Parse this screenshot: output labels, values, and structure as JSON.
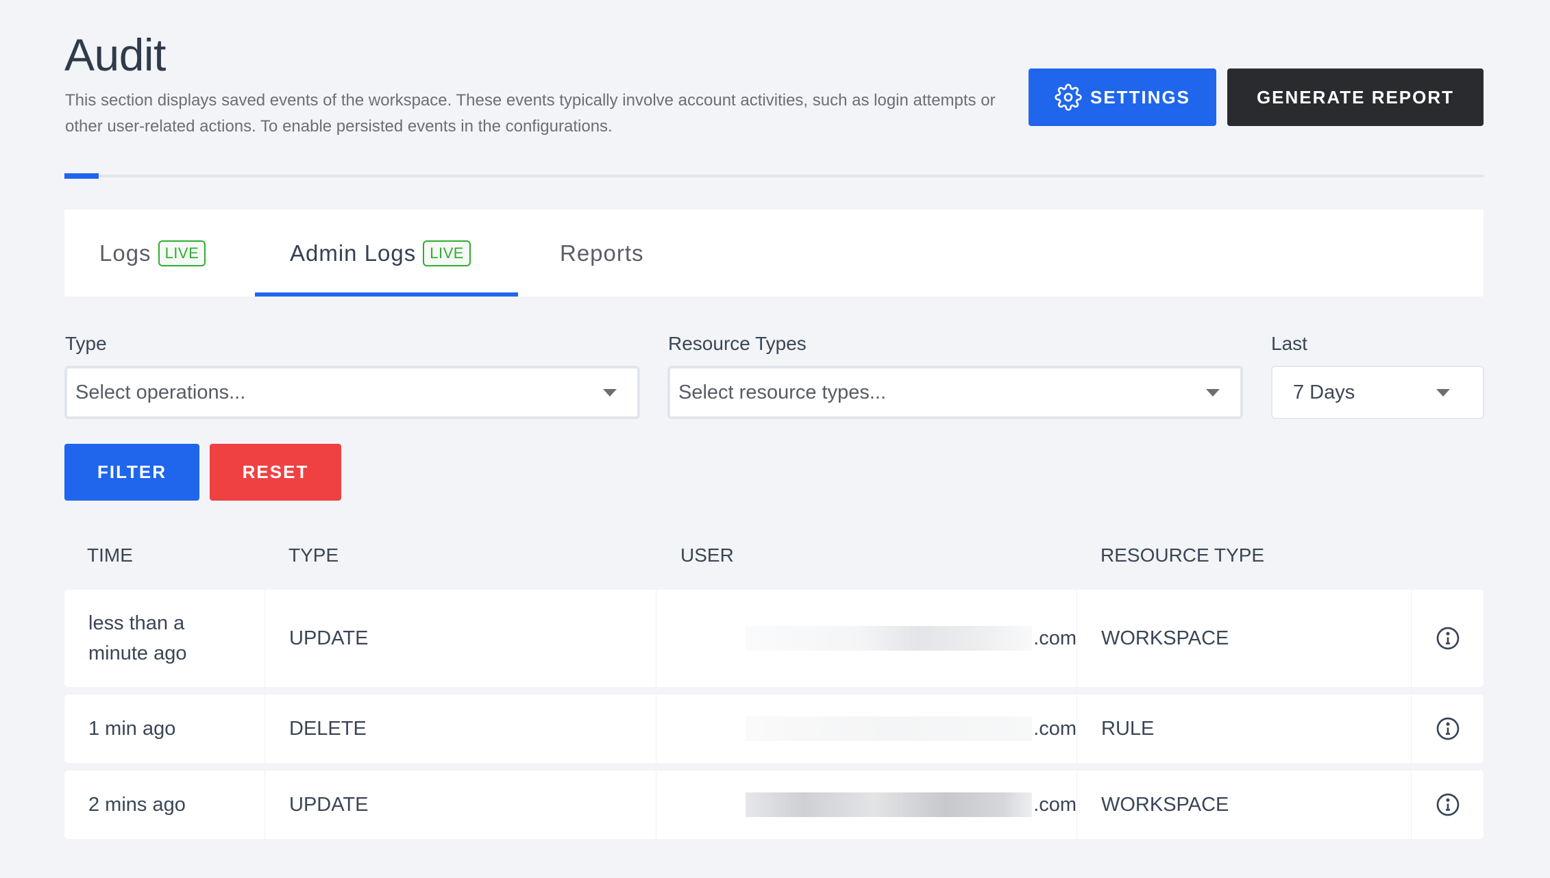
{
  "header": {
    "title": "Audit",
    "description": "This section displays saved events of the workspace. These events typically involve account activities, such as login attempts or other user-related actions. To enable persisted events in the configurations.",
    "settings_label": "SETTINGS",
    "settings_icon": "gear-icon",
    "generate_report_label": "GENERATE REPORT"
  },
  "colors": {
    "primary": "#1f66ec",
    "danger": "#ef4142",
    "dark": "#2a2b2e",
    "live": "#2fae2f",
    "background": "#f2f4f8"
  },
  "tabs": [
    {
      "label": "Logs",
      "badge": "LIVE",
      "active": false
    },
    {
      "label": "Admin Logs",
      "badge": "LIVE",
      "active": true
    },
    {
      "label": "Reports",
      "badge": null,
      "active": false
    }
  ],
  "filters": {
    "type": {
      "label": "Type",
      "placeholder": "Select operations..."
    },
    "resource_types": {
      "label": "Resource Types",
      "placeholder": "Select resource types..."
    },
    "last": {
      "label": "Last",
      "value": "7 Days"
    },
    "filter_label": "FILTER",
    "reset_label": "RESET"
  },
  "table": {
    "columns": [
      "TIME",
      "TYPE",
      "USER",
      "RESOURCE TYPE"
    ],
    "rows": [
      {
        "time": "less than a minute ago",
        "type": "UPDATE",
        "user_suffix": ".com",
        "resource_type": "WORKSPACE"
      },
      {
        "time": "1 min ago",
        "type": "DELETE",
        "user_suffix": ".com",
        "resource_type": "RULE"
      },
      {
        "time": "2 mins ago",
        "type": "UPDATE",
        "user_suffix": ".com",
        "resource_type": "WORKSPACE"
      }
    ]
  }
}
